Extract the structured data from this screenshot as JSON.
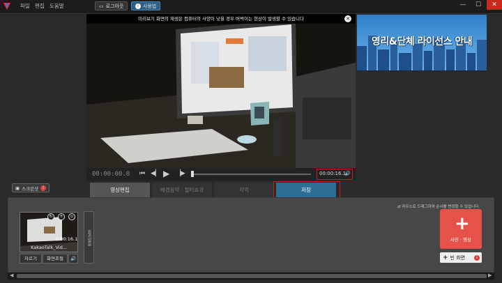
{
  "menu": [
    "파일",
    "편집",
    "도움말"
  ],
  "header": {
    "logout_label": "로그아웃",
    "help_label": "사용법"
  },
  "window": {
    "minimize": "—",
    "maximize": "☐",
    "close": "✕"
  },
  "preview": {
    "notice": "미리보기 화면의 재생은 컴퓨터의 사양이 낮을 경우 버벅이는 현상이 발생할 수 있습니다"
  },
  "ad": {
    "text": "영리&단체 라이선스 안내"
  },
  "transport": {
    "time_current": "00:00:00.0",
    "time_total": "00:00:16.1"
  },
  "screenshot_label": "스크린샷",
  "tabs": [
    {
      "label": "영상편집"
    },
    {
      "label": "배경음악 · 필터효과"
    },
    {
      "label": "자막"
    },
    {
      "label": "저장"
    }
  ],
  "timeline": {
    "hint": "마우스로 드래그하여 순서를 변경할 수 있습니다.",
    "clip_title": "KakaoTalk_Vid...",
    "clip_time": "0:00:16.1",
    "trim_label": "자르기",
    "adjust_label": "화면조절",
    "transition_label": "효과없음",
    "add_media_label": "사진 · 영상",
    "blank_screen_label": "빈 화면"
  },
  "colors": {
    "accent": "#2d6f94",
    "highlight": "#d0191f",
    "add": "#e6524a"
  }
}
